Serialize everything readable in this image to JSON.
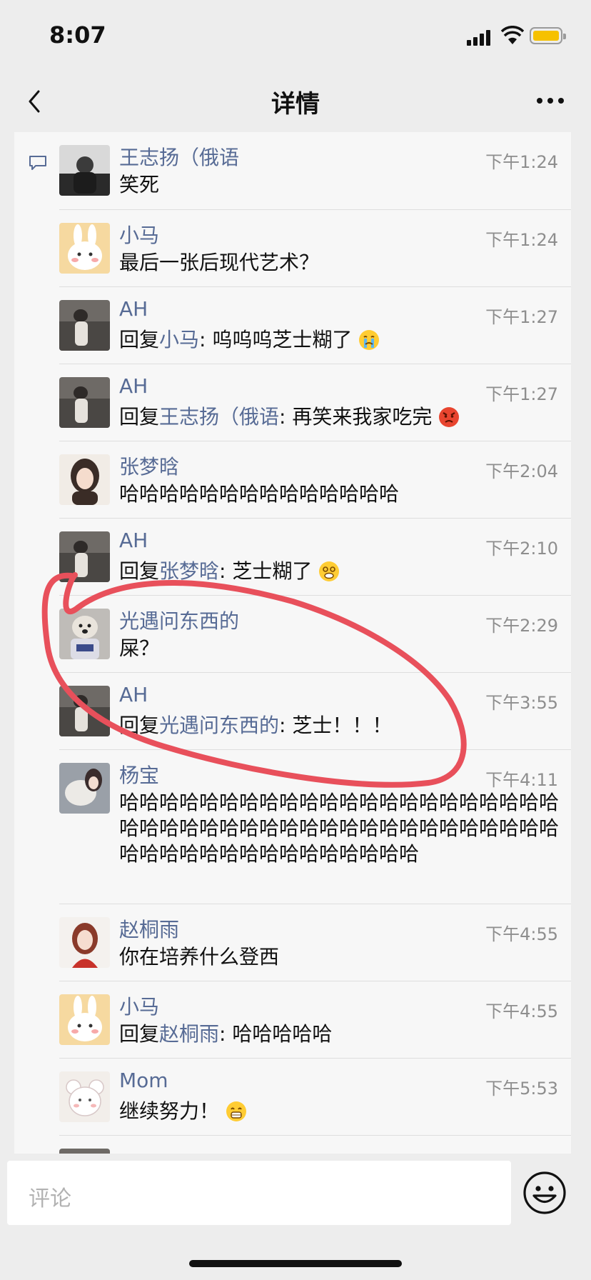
{
  "status_bar": {
    "time": "8:07"
  },
  "nav": {
    "title": "详情"
  },
  "comments": [
    {
      "name": "王志扬（俄语",
      "time": "下午1:24",
      "text": "笑死"
    },
    {
      "name": "小马",
      "time": "下午1:24",
      "text": "最后一张后现代艺术？"
    },
    {
      "name": "AH",
      "time": "下午1:27",
      "reply_word": "回复",
      "reply_to": "小马",
      "text": ": 呜呜呜芝士糊了",
      "emoji": "crying-emoji"
    },
    {
      "name": "AH",
      "time": "下午1:27",
      "reply_word": "回复",
      "reply_to": "王志扬（俄语",
      "text": ": 再笑来我家吃完",
      "emoji": "angry-emoji"
    },
    {
      "name": "张梦晗",
      "time": "下午2:04",
      "text": "哈哈哈哈哈哈哈哈哈哈哈哈哈哈"
    },
    {
      "name": "AH",
      "time": "下午2:10",
      "reply_word": "回复",
      "reply_to": "张梦晗",
      "text": ": 芝士糊了",
      "emoji": "dizzy-emoji"
    },
    {
      "name": "光遇问东西的",
      "time": "下午2:29",
      "text": "屎？"
    },
    {
      "name": "AH",
      "time": "下午3:55",
      "reply_word": "回复",
      "reply_to": "光遇问东西的",
      "text": ": 芝士！！！"
    },
    {
      "name": "杨宝",
      "time": "下午4:11",
      "text": "哈哈哈哈哈哈哈哈哈哈哈哈哈哈哈哈哈哈哈哈哈哈哈哈哈哈哈哈哈哈哈哈哈哈哈哈哈哈哈哈哈哈哈哈哈哈哈哈哈哈哈哈哈哈哈哈哈哈哈"
    },
    {
      "name": "赵桐雨",
      "time": "下午4:55",
      "text": "你在培养什么登西"
    },
    {
      "name": "小马",
      "time": "下午4:55",
      "reply_word": "回复",
      "reply_to": "赵桐雨",
      "text": ": 哈哈哈哈哈"
    },
    {
      "name": "Mom",
      "time": "下午5:53",
      "text": "继续努力！",
      "emoji": "grin-emoji"
    }
  ],
  "input": {
    "placeholder": "评论"
  },
  "colors": {
    "link": "#576b95",
    "annotation_circle": "#e8505b"
  }
}
